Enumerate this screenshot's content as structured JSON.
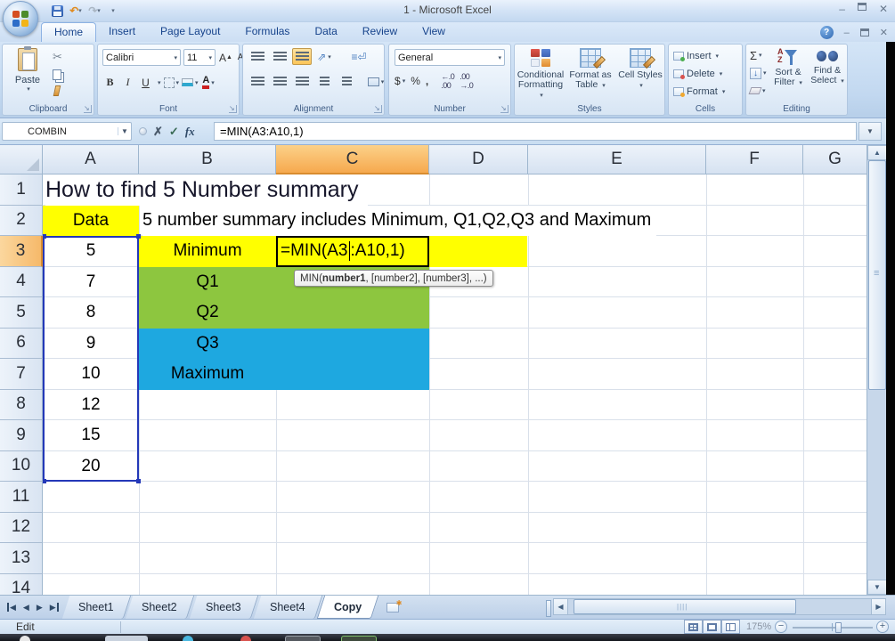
{
  "window": {
    "title": "1 - Microsoft Excel"
  },
  "ribbon": {
    "tabs": [
      {
        "label": "Home",
        "active": true
      },
      {
        "label": "Insert"
      },
      {
        "label": "Page Layout"
      },
      {
        "label": "Formulas"
      },
      {
        "label": "Data"
      },
      {
        "label": "Review"
      },
      {
        "label": "View"
      }
    ],
    "clipboard": {
      "label": "Clipboard",
      "paste": "Paste"
    },
    "font": {
      "label": "Font",
      "name": "Calibri",
      "size": "11",
      "bold": "B",
      "italic": "I",
      "underline": "U"
    },
    "alignment": {
      "label": "Alignment"
    },
    "number": {
      "label": "Number",
      "format": "General",
      "currency": "$",
      "percent": "%",
      "comma": ","
    },
    "styles": {
      "label": "Styles",
      "conditional": "Conditional Formatting",
      "format_table": "Format as Table",
      "cell_styles": "Cell Styles"
    },
    "cells": {
      "label": "Cells",
      "insert": "Insert",
      "delete": "Delete",
      "format": "Format"
    },
    "editing": {
      "label": "Editing",
      "sort_filter": "Sort & Filter",
      "find_select": "Find & Select"
    }
  },
  "formula_bar": {
    "name_box": "COMBIN",
    "fx": "fx",
    "formula": "=MIN(A3:A10,1)"
  },
  "sheet": {
    "columns": [
      "A",
      "B",
      "C",
      "D",
      "E",
      "F",
      "G"
    ],
    "active_column": "C",
    "rows": [
      "1",
      "2",
      "3",
      "4",
      "5",
      "6",
      "7",
      "8",
      "9",
      "10",
      "11",
      "12",
      "13",
      "14"
    ],
    "active_row": "3",
    "title": "How to find 5 Number summary",
    "data_header": "Data",
    "note": "5 number summary includes Minimum, Q1,Q2,Q3 and Maximum",
    "data_values": [
      "5",
      "7",
      "8",
      "9",
      "10",
      "12",
      "15",
      "20"
    ],
    "labels": {
      "minimum": "Minimum",
      "q1": "Q1",
      "q2": "Q2",
      "q3": "Q3",
      "maximum": "Maximum"
    },
    "edit_formula": {
      "before_cursor": "=MIN(A3",
      "after_cursor": ":A10,1)"
    },
    "tooltip": {
      "prefix": "MIN(",
      "arg_bold": "number1",
      "suffix": ", [number2], [number3], ...)"
    },
    "colors": {
      "highlight_yellow": "#FFFF00",
      "fill_green": "#8DC63F",
      "fill_blue": "#1EA8E0",
      "header_active": "#F9BE67",
      "selection_border": "#2438B8"
    }
  },
  "sheet_tabs": [
    {
      "label": "Sheet1"
    },
    {
      "label": "Sheet2"
    },
    {
      "label": "Sheet3"
    },
    {
      "label": "Sheet4"
    },
    {
      "label": "Copy",
      "active": true
    }
  ],
  "status_bar": {
    "mode": "Edit",
    "zoom_level": "175%"
  }
}
